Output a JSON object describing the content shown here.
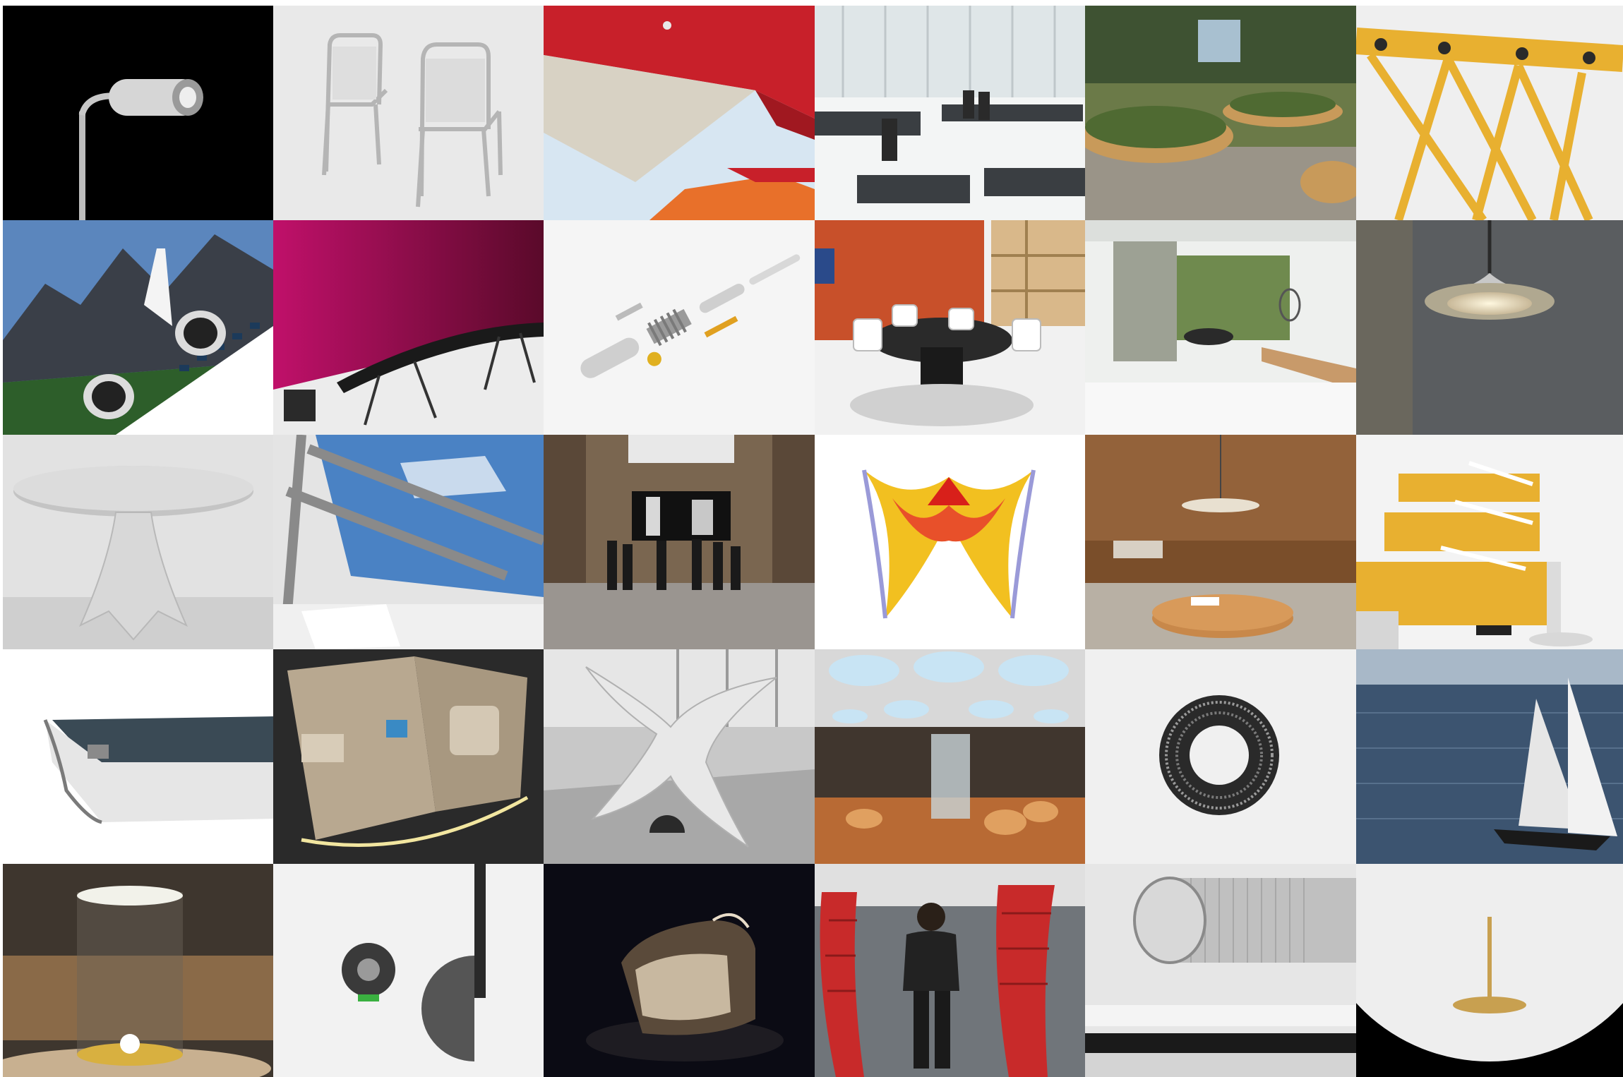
{
  "colors": {
    "page_background": "#ffffff",
    "accent_red": "#c8202a",
    "accent_yellow": "#e8b030",
    "accent_magenta": "#b01060"
  },
  "tiles": [
    {
      "row": 1,
      "col": 1,
      "subject": "street-lamp-icon",
      "background": "#000000"
    },
    {
      "row": 1,
      "col": 2,
      "subject": "aluminium-chairs-icon",
      "background": "#e9e9e9"
    },
    {
      "row": 1,
      "col": 3,
      "subject": "red-canopy-icon",
      "background": "#cfe0ee"
    },
    {
      "row": 1,
      "col": 4,
      "subject": "airport-lounge-icon",
      "background": "#f0f2f2"
    },
    {
      "row": 1,
      "col": 5,
      "subject": "garden-seating-icon",
      "background": "#5a6a3c"
    },
    {
      "row": 1,
      "col": 6,
      "subject": "yellow-truss-icon",
      "background": "#eeeeee"
    },
    {
      "row": 2,
      "col": 1,
      "subject": "jet-aircraft-icon",
      "background": "#4d78b0"
    },
    {
      "row": 2,
      "col": 2,
      "subject": "magenta-office-icon",
      "background": "#ededed"
    },
    {
      "row": 2,
      "col": 3,
      "subject": "exploded-parts-icon",
      "background": "#f4f4f4"
    },
    {
      "row": 2,
      "col": 4,
      "subject": "meeting-room-icon",
      "background": "#eeeeee"
    },
    {
      "row": 2,
      "col": 5,
      "subject": "bathroom-interior-icon",
      "background": "#e8ecea"
    },
    {
      "row": 2,
      "col": 6,
      "subject": "pendant-lamp-icon",
      "background": "#55585c"
    },
    {
      "row": 3,
      "col": 1,
      "subject": "round-table-icon",
      "background": "#dcdcdc"
    },
    {
      "row": 3,
      "col": 2,
      "subject": "skylight-icon",
      "background": "#5c8ec4"
    },
    {
      "row": 3,
      "col": 3,
      "subject": "gallery-hall-icon",
      "background": "#6e5c48"
    },
    {
      "row": 3,
      "col": 4,
      "subject": "structure-render-icon",
      "background": "#ffffff"
    },
    {
      "row": 3,
      "col": 5,
      "subject": "wood-lounge-icon",
      "background": "#8a5a34"
    },
    {
      "row": 3,
      "col": 6,
      "subject": "yellow-workstations-icon",
      "background": "#f1f1f1"
    },
    {
      "row": 4,
      "col": 1,
      "subject": "aluminium-profile-icon",
      "background": "#ffffff"
    },
    {
      "row": 4,
      "col": 2,
      "subject": "aircraft-cabin-icon",
      "background": "#2c2c2c"
    },
    {
      "row": 4,
      "col": 3,
      "subject": "sculpture-workshop-icon",
      "background": "#c2c2c2"
    },
    {
      "row": 4,
      "col": 4,
      "subject": "yacht-interior-icon",
      "background": "#38302a"
    },
    {
      "row": 4,
      "col": 5,
      "subject": "torus-pattern-icon",
      "background": "#f0f0f0"
    },
    {
      "row": 4,
      "col": 6,
      "subject": "sailing-yacht-icon",
      "background": "#3a5068"
    },
    {
      "row": 5,
      "col": 1,
      "subject": "table-lamp-icon",
      "background": "#3c342c"
    },
    {
      "row": 5,
      "col": 2,
      "subject": "wall-mount-icon",
      "background": "#f2f2f2"
    },
    {
      "row": 5,
      "col": 3,
      "subject": "armchair-icon",
      "background": "#0a0a12"
    },
    {
      "row": 5,
      "col": 4,
      "subject": "red-seat-pod-icon",
      "background": "#6a6e72"
    },
    {
      "row": 5,
      "col": 5,
      "subject": "handle-detail-icon",
      "background": "#e4e4e4"
    },
    {
      "row": 5,
      "col": 6,
      "subject": "ceiling-lamp-icon",
      "background": "#000000"
    }
  ]
}
